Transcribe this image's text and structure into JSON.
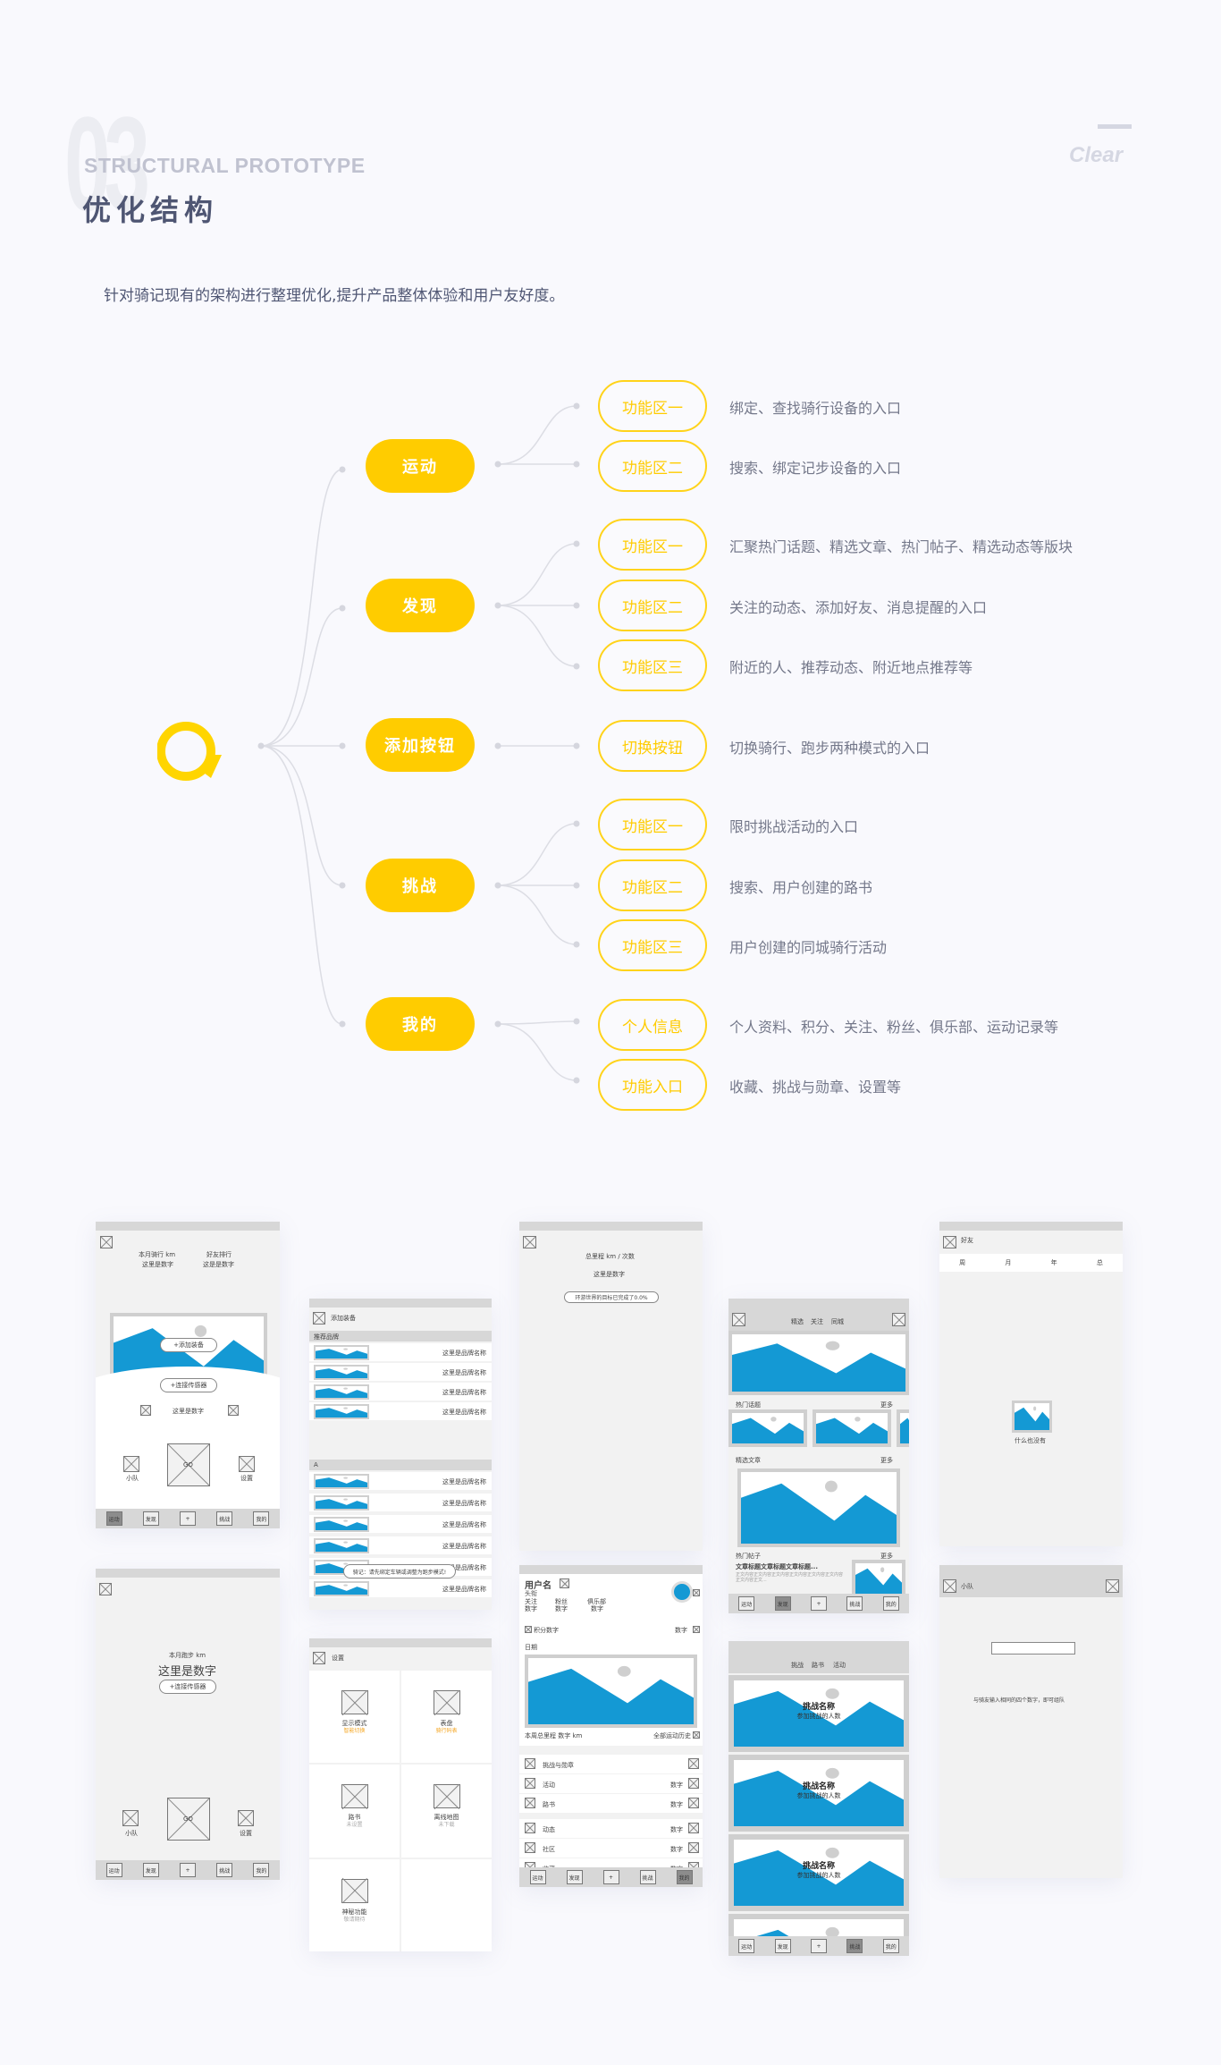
{
  "header": {
    "section_number": "03",
    "en_title": "STRUCTURAL PROTOTYPE",
    "cn_title": "优化结构",
    "description": "针对骑记现有的架构进行整理优化,提升产品整体体验和用户友好度。",
    "brand_word": "Clear"
  },
  "colors": {
    "accent": "#ffcc00",
    "title": "#4f5673",
    "line": "#dadbe2",
    "wire_blue": "#1499d4"
  },
  "tree": {
    "root_icon": "qiji-logo-icon",
    "categories": [
      {
        "label": "运动",
        "children": [
          {
            "label": "功能区一",
            "desc": "绑定、查找骑行设备的入口"
          },
          {
            "label": "功能区二",
            "desc": "搜索、绑定记步设备的入口"
          }
        ]
      },
      {
        "label": "发现",
        "children": [
          {
            "label": "功能区一",
            "desc": "汇聚热门话题、精选文章、热门帖子、精选动态等版块"
          },
          {
            "label": "功能区二",
            "desc": "关注的动态、添加好友、消息提醒的入口"
          },
          {
            "label": "功能区三",
            "desc": "附近的人、推荐动态、附近地点推荐等"
          }
        ]
      },
      {
        "label": "添加按钮",
        "children": [
          {
            "label": "切换按钮",
            "desc": "切换骑行、跑步两种模式的入口"
          }
        ]
      },
      {
        "label": "挑战",
        "children": [
          {
            "label": "功能区一",
            "desc": "限时挑战活动的入口"
          },
          {
            "label": "功能区二",
            "desc": "搜索、用户创建的路书"
          },
          {
            "label": "功能区三",
            "desc": "用户创建的同城骑行活动"
          }
        ]
      },
      {
        "label": "我的",
        "children": [
          {
            "label": "个人信息",
            "desc": "个人资料、积分、关注、粉丝、俱乐部、运动记录等"
          },
          {
            "label": "功能入口",
            "desc": "收藏、挑战与勋章、设置等"
          }
        ]
      }
    ]
  },
  "tabbar": [
    "运动",
    "发现",
    "+",
    "挑战",
    "我的"
  ],
  "wireframes": {
    "ride_home": {
      "stat1_label": "本月骑行 km",
      "stat1_value": "这里是数字",
      "stat2_label": "好友排行",
      "stat2_value": "这是是数字",
      "add_gear": "+添加装备",
      "connect_sensor": "+连接传感器",
      "number": "这里是数字",
      "go": "GO",
      "team": "小队",
      "settings": "设置"
    },
    "run_home": {
      "label": "本月跑步 km",
      "value": "这里是数字",
      "connect_sensor": "+连接传感器",
      "go": "GO",
      "team": "小队",
      "settings": "设置"
    },
    "add_gear": {
      "title": "添加装备",
      "section1": "推荐品牌",
      "section2": "A",
      "brand_name": "这里是品牌名称",
      "toast": "骑记：请先绑定车辆或调整为跑步模式!"
    },
    "device_settings": {
      "title": "设置",
      "items": [
        {
          "label": "显示模式",
          "sub": "智能切换",
          "highlight": true
        },
        {
          "label": "表盘",
          "sub": "骑行码表",
          "highlight": true
        },
        {
          "label": "路书",
          "sub": "未设置",
          "highlight": false
        },
        {
          "label": "离线地图",
          "sub": "未下载",
          "highlight": false
        },
        {
          "label": "神秘功能",
          "sub": "敬请期待",
          "highlight": false
        }
      ]
    },
    "total_stats": {
      "label": "总里程 km / 次数",
      "value": "这里是数字",
      "progress_text": "环游世界的目标已完成了0.0%"
    },
    "profile": {
      "username": "用户名",
      "title": "头衔",
      "stats": [
        {
          "label": "关注",
          "value": "数字"
        },
        {
          "label": "粉丝",
          "value": "数字"
        },
        {
          "label": "俱乐部",
          "value": "数字"
        }
      ],
      "points": "积分数字",
      "points_right": "数字",
      "date": "日期",
      "week_total": "本周总里程 数字 km",
      "history": "全部运动历史",
      "group1": [
        {
          "label": "挑战与勋章",
          "value": ""
        },
        {
          "label": "活动",
          "value": "数字"
        },
        {
          "label": "路书",
          "value": "数字"
        }
      ],
      "group2": [
        {
          "label": "动态",
          "value": "数字"
        },
        {
          "label": "社区",
          "value": "数字"
        },
        {
          "label": "收藏",
          "value": "数字"
        }
      ]
    },
    "discover": {
      "tabs": [
        "精选",
        "关注",
        "同城"
      ],
      "hot_topics": "热门话题",
      "featured": "精选文章",
      "hot_posts": "热门帖子",
      "more": "更多",
      "post_title": "文章标题文章标题文章标题...",
      "post_body": "正文内容正文内容正文内容正文内容正文内容正文内容正文内容正文..."
    },
    "challenge": {
      "tabs": [
        "挑战",
        "路书",
        "活动"
      ],
      "card_title": "挑战名称",
      "card_sub": "参加挑战的人数"
    },
    "friends_rank": {
      "title": "好友",
      "periods": [
        "周",
        "月",
        "年",
        "总"
      ],
      "empty": "什么也没有"
    },
    "team": {
      "title": "小队",
      "hint": "与骑友输入相同的四个数字，即可组队"
    }
  }
}
